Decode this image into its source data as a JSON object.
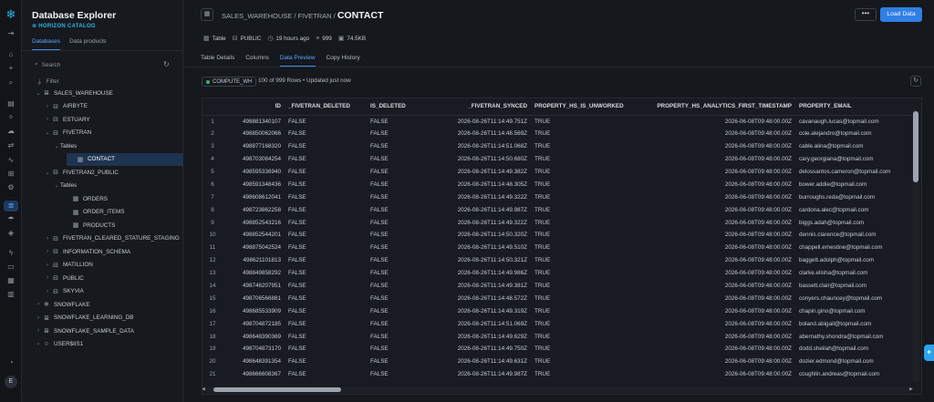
{
  "rail": {
    "logo": "snowflake-logo",
    "items": [
      {
        "name": "collapse-icon",
        "glyph": "⇥",
        "active": false
      },
      {
        "name": "home-icon",
        "glyph": "⌂",
        "active": false
      },
      {
        "name": "add-icon",
        "glyph": "+",
        "active": false
      },
      {
        "name": "search-icon",
        "glyph": "⌕",
        "active": false
      },
      {
        "name": "projects-icon",
        "glyph": "▤",
        "active": false
      },
      {
        "name": "ai-icon",
        "glyph": "✧",
        "active": false
      },
      {
        "name": "data-icon",
        "glyph": "☁",
        "active": false
      },
      {
        "name": "share-icon",
        "glyph": "⇄",
        "active": false
      },
      {
        "name": "monitor-icon",
        "glyph": "∿",
        "active": false
      },
      {
        "name": "apps-icon",
        "glyph": "⊞",
        "active": false
      },
      {
        "name": "settings-icon",
        "glyph": "⚙",
        "active": false
      },
      {
        "name": "database-icon",
        "glyph": "≣",
        "active": true
      },
      {
        "name": "cloud-icon",
        "glyph": "☂",
        "active": false
      },
      {
        "name": "shield-icon",
        "glyph": "◈",
        "active": false
      },
      {
        "name": "bolt-icon",
        "glyph": "ϟ",
        "active": false
      },
      {
        "name": "chat-icon",
        "glyph": "▭",
        "active": false
      },
      {
        "name": "docs-icon",
        "glyph": "▦",
        "active": false
      },
      {
        "name": "notes-icon",
        "glyph": "▥",
        "active": false
      },
      {
        "name": "bell-icon",
        "glyph": "◔",
        "active": false
      }
    ],
    "avatar": "E"
  },
  "sidebar": {
    "title": "Database Explorer",
    "subtitle": "HORIZON CATALOG",
    "tabs": [
      {
        "label": "Databases",
        "active": true
      },
      {
        "label": "Data products",
        "active": false
      }
    ],
    "search_placeholder": "Search",
    "filter_label": "Filter",
    "tree": [
      {
        "label": "SALES_WAREHOUSE",
        "indent": 0,
        "chev": "⌄",
        "icon": "≣",
        "selected": false
      },
      {
        "label": "AIRBYTE",
        "indent": 1,
        "chev": "›",
        "icon": "⊟",
        "selected": false
      },
      {
        "label": "ESTUARY",
        "indent": 1,
        "chev": "›",
        "icon": "⊟",
        "selected": false
      },
      {
        "label": "FIVETRAN",
        "indent": 1,
        "chev": "⌄",
        "icon": "⊟",
        "selected": false
      },
      {
        "label": "Tables",
        "indent": 2,
        "chev": "⌄",
        "icon": "",
        "selected": false
      },
      {
        "label": "CONTACT",
        "indent": 3,
        "chev": "",
        "icon": "▦",
        "selected": true
      },
      {
        "label": "FIVETRAN2_PUBLIC",
        "indent": 1,
        "chev": "⌄",
        "icon": "⊟",
        "selected": false
      },
      {
        "label": "Tables",
        "indent": 2,
        "chev": "⌄",
        "icon": "",
        "selected": false
      },
      {
        "label": "ORDERS",
        "indent": 3,
        "chev": "",
        "icon": "▦",
        "selected": false
      },
      {
        "label": "ORDER_ITEMS",
        "indent": 3,
        "chev": "",
        "icon": "▦",
        "selected": false
      },
      {
        "label": "PRODUCTS",
        "indent": 3,
        "chev": "",
        "icon": "▦",
        "selected": false
      },
      {
        "label": "FIVETRAN_CLEARED_STATURE_STAGING",
        "indent": 1,
        "chev": "›",
        "icon": "⊟",
        "selected": false
      },
      {
        "label": "INFORMATION_SCHEMA",
        "indent": 1,
        "chev": "›",
        "icon": "⊟",
        "selected": false
      },
      {
        "label": "MATILLION",
        "indent": 1,
        "chev": "›",
        "icon": "⊟",
        "selected": false
      },
      {
        "label": "PUBLIC",
        "indent": 1,
        "chev": "›",
        "icon": "⊟",
        "selected": false
      },
      {
        "label": "SKYVIA",
        "indent": 1,
        "chev": "›",
        "icon": "⊟",
        "selected": false
      },
      {
        "label": "SNOWFLAKE",
        "indent": 0,
        "chev": "›",
        "icon": "❄",
        "selected": false
      },
      {
        "label": "SNOWFLAKE_LEARNING_DB",
        "indent": 0,
        "chev": "›",
        "icon": "≣",
        "selected": false
      },
      {
        "label": "SNOWFLAKE_SAMPLE_DATA",
        "indent": 0,
        "chev": "›",
        "icon": "≣",
        "selected": false
      },
      {
        "label": "USER$IIS1",
        "indent": 0,
        "chev": "›",
        "icon": "☺",
        "selected": false
      }
    ]
  },
  "header": {
    "breadcrumb_path": "SALES_WAREHOUSE / FIVETRAN / ",
    "current": "CONTACT",
    "more_label": "•••",
    "load_label": "Load Data"
  },
  "meta": [
    {
      "icon": "▦",
      "name": "type",
      "label": "Table"
    },
    {
      "icon": "⊟",
      "name": "schema",
      "label": "PUBLIC"
    },
    {
      "icon": "◷",
      "name": "updated",
      "label": "19 hours ago"
    },
    {
      "icon": "≡",
      "name": "rows",
      "label": "999"
    },
    {
      "icon": "▣",
      "name": "size",
      "label": "74.5KB"
    }
  ],
  "tabs": [
    {
      "label": "Table Details",
      "active": false
    },
    {
      "label": "Columns",
      "active": false
    },
    {
      "label": "Data Preview",
      "active": true
    },
    {
      "label": "Copy History",
      "active": false
    }
  ],
  "preview": {
    "warehouse": "COMPUTE_WH",
    "rows_info": "100 of 999 Rows • Updated just now"
  },
  "table": {
    "columns": [
      "",
      "ID",
      "_FIVETRAN_DELETED",
      "IS_DELETED",
      "_FIVETRAN_SYNCED",
      "PROPERTY_HS_IS_UNWORKED",
      "PROPERTY_HS_ANALYTICS_FIRST_TIMESTAMP",
      "PROPERTY_EMAIL"
    ],
    "rows": [
      [
        "1",
        "498881340107",
        "FALSE",
        "FALSE",
        "2026-08-26T11:14:49.751Z",
        "TRUE",
        "2026-06-08T09:48:00.00Z",
        "cavanaugh.lucas@topmail.com"
      ],
      [
        "2",
        "498850062066",
        "FALSE",
        "FALSE",
        "2026-08-26T11:14:48.569Z",
        "TRUE",
        "2026-06-08T09:48:00.00Z",
        "cole.alejandro@topmail.com"
      ],
      [
        "3",
        "498877168320",
        "FALSE",
        "FALSE",
        "2026-08-26T11:14:51.068Z",
        "TRUE",
        "2026-06-08T09:48:00.00Z",
        "cable.alina@topmail.com"
      ],
      [
        "4",
        "498703084254",
        "FALSE",
        "FALSE",
        "2026-08-26T11:14:50.680Z",
        "TRUE",
        "2026-06-08T09:48:00.00Z",
        "cary.georgiana@topmail.com"
      ],
      [
        "5",
        "498595336940",
        "FALSE",
        "FALSE",
        "2026-08-26T11:14:49.382Z",
        "TRUE",
        "2026-06-08T09:48:00.00Z",
        "delossantos.cameron@topmail.com"
      ],
      [
        "6",
        "498591348436",
        "FALSE",
        "FALSE",
        "2026-08-26T11:14:48.305Z",
        "TRUE",
        "2026-06-08T09:48:00.00Z",
        "bower.addie@topmail.com"
      ],
      [
        "7",
        "498608612041",
        "FALSE",
        "FALSE",
        "2026-08-26T11:14:49.322Z",
        "TRUE",
        "2026-06-08T09:48:00.00Z",
        "burroughs.reda@topmail.com"
      ],
      [
        "8",
        "498723862258",
        "FALSE",
        "FALSE",
        "2026-08-26T11:14:49.987Z",
        "TRUE",
        "2026-06-08T09:48:00.00Z",
        "cardona.alec@topmail.com"
      ],
      [
        "9",
        "498852543216",
        "FALSE",
        "FALSE",
        "2026-08-26T11:14:49.322Z",
        "TRUE",
        "2026-06-08T09:48:00.00Z",
        "biggs.adah@topmail.com"
      ],
      [
        "10",
        "498852544201",
        "FALSE",
        "FALSE",
        "2026-08-26T11:14:50.320Z",
        "TRUE",
        "2026-06-08T09:48:00.00Z",
        "dennis.clarence@topmail.com"
      ],
      [
        "11",
        "498875042524",
        "FALSE",
        "FALSE",
        "2026-08-26T11:14:49.510Z",
        "TRUE",
        "2026-06-08T09:48:00.00Z",
        "chappell.ernestine@topmail.com"
      ],
      [
        "12",
        "498621101813",
        "FALSE",
        "FALSE",
        "2026-08-26T11:14:50.321Z",
        "TRUE",
        "2026-06-08T09:48:00.00Z",
        "baggett.adolph@topmail.com"
      ],
      [
        "13",
        "498849858292",
        "FALSE",
        "FALSE",
        "2026-08-26T11:14:49.986Z",
        "TRUE",
        "2026-06-08T09:48:00.00Z",
        "clarke.elisha@topmail.com"
      ],
      [
        "14",
        "498746207951",
        "FALSE",
        "FALSE",
        "2026-08-26T11:14:49.381Z",
        "TRUE",
        "2026-06-08T09:48:00.00Z",
        "bassett.clair@topmail.com"
      ],
      [
        "15",
        "498706566881",
        "FALSE",
        "FALSE",
        "2026-08-26T11:14:48.572Z",
        "TRUE",
        "2026-06-08T09:48:00.00Z",
        "conyers.chauncey@topmail.com"
      ],
      [
        "16",
        "498685533909",
        "FALSE",
        "FALSE",
        "2026-08-26T11:14:49.319Z",
        "TRUE",
        "2026-06-08T09:48:00.00Z",
        "chapin.gino@topmail.com"
      ],
      [
        "17",
        "498704872185",
        "FALSE",
        "FALSE",
        "2026-08-26T11:14:51.069Z",
        "TRUE",
        "2026-06-08T09:48:00.00Z",
        "boland.abigail@topmail.com"
      ],
      [
        "18",
        "498648390369",
        "FALSE",
        "FALSE",
        "2026-08-26T11:14:49.629Z",
        "TRUE",
        "2026-06-08T09:48:00.00Z",
        "abernathy.shondra@topmail.com"
      ],
      [
        "19",
        "498704873170",
        "FALSE",
        "FALSE",
        "2026-08-26T11:14:49.750Z",
        "TRUE",
        "2026-06-08T09:48:00.00Z",
        "dodd.sheilah@topmail.com"
      ],
      [
        "20",
        "498648391354",
        "FALSE",
        "FALSE",
        "2026-08-26T11:14:49.631Z",
        "TRUE",
        "2026-06-08T09:48:00.00Z",
        "dozier.edmond@topmail.com"
      ],
      [
        "21",
        "498666608367",
        "FALSE",
        "FALSE",
        "2026-08-26T11:14:49.987Z",
        "TRUE",
        "2026-06-08T09:48:00.00Z",
        "coughlin.andreas@topmail.com"
      ]
    ]
  },
  "colors": {
    "accent": "#2f7fe6",
    "brand": "#29b5e8",
    "background": "#15181d"
  }
}
